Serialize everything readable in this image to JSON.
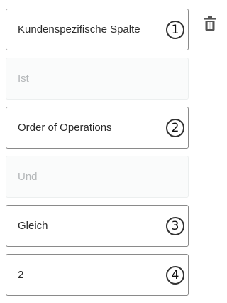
{
  "rows": [
    {
      "label": "Kundenspezifische Spalte",
      "marker": "1"
    },
    {
      "label": "Ist"
    },
    {
      "label": "Order of Operations",
      "marker": "2"
    },
    {
      "label": "Und"
    },
    {
      "label": "Gleich",
      "marker": "3"
    },
    {
      "label": "2",
      "marker": "4"
    }
  ],
  "icons": {
    "delete": "trash-icon"
  },
  "colors": {
    "field_border": "#8a8a8a",
    "disabled_text": "#b4b7b9",
    "disabled_bg": "#fafbfb",
    "icon": "#555555"
  }
}
